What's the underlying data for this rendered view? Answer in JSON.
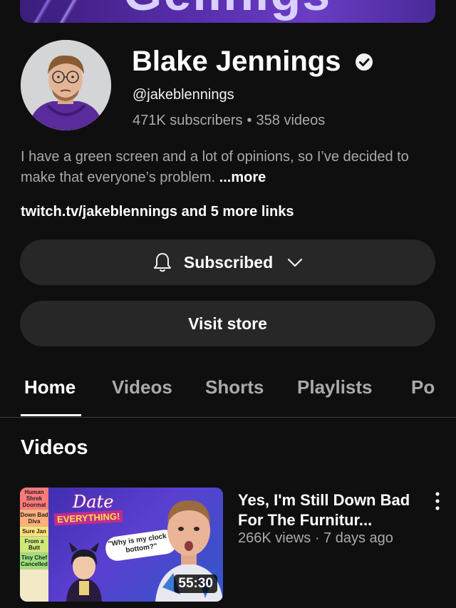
{
  "banner": {
    "text": "Gelinigs"
  },
  "channel": {
    "name": "Blake Jennings",
    "handle": "@jakeblennings",
    "subscribers": "471K subscribers",
    "separator": "•",
    "videos": "358 videos",
    "description": "I have a green screen and a lot of opinions, so I’ve decided to make that everyone’s problem.",
    "more_label": "...more",
    "link_text": "twitch.tv/jakeblennings",
    "more_links": " and 5 more links"
  },
  "buttons": {
    "subscribed": "Subscribed",
    "visit_store": "Visit store"
  },
  "tabs": [
    "Home",
    "Videos",
    "Shorts",
    "Playlists",
    "Po"
  ],
  "section": {
    "title": "Videos"
  },
  "video": {
    "title": "Yes, I'm Still Down Bad For The Furnitur...",
    "meta": "266K views · 7 days ago",
    "duration": "55:30",
    "thumb": {
      "tiers": [
        "Human Shrek Doormat",
        "Down Bad Diva",
        "Sure Jan",
        "From a Butt",
        "Tiny Chef Cancelled"
      ],
      "logo": "Date",
      "logo_sub": "EVERYTHING!",
      "bubble": "\"Why is my clock a bottom?\""
    }
  },
  "colors": {
    "background": "#0f0f0f",
    "pill": "#272727",
    "secondary_text": "#aaaaaa"
  }
}
